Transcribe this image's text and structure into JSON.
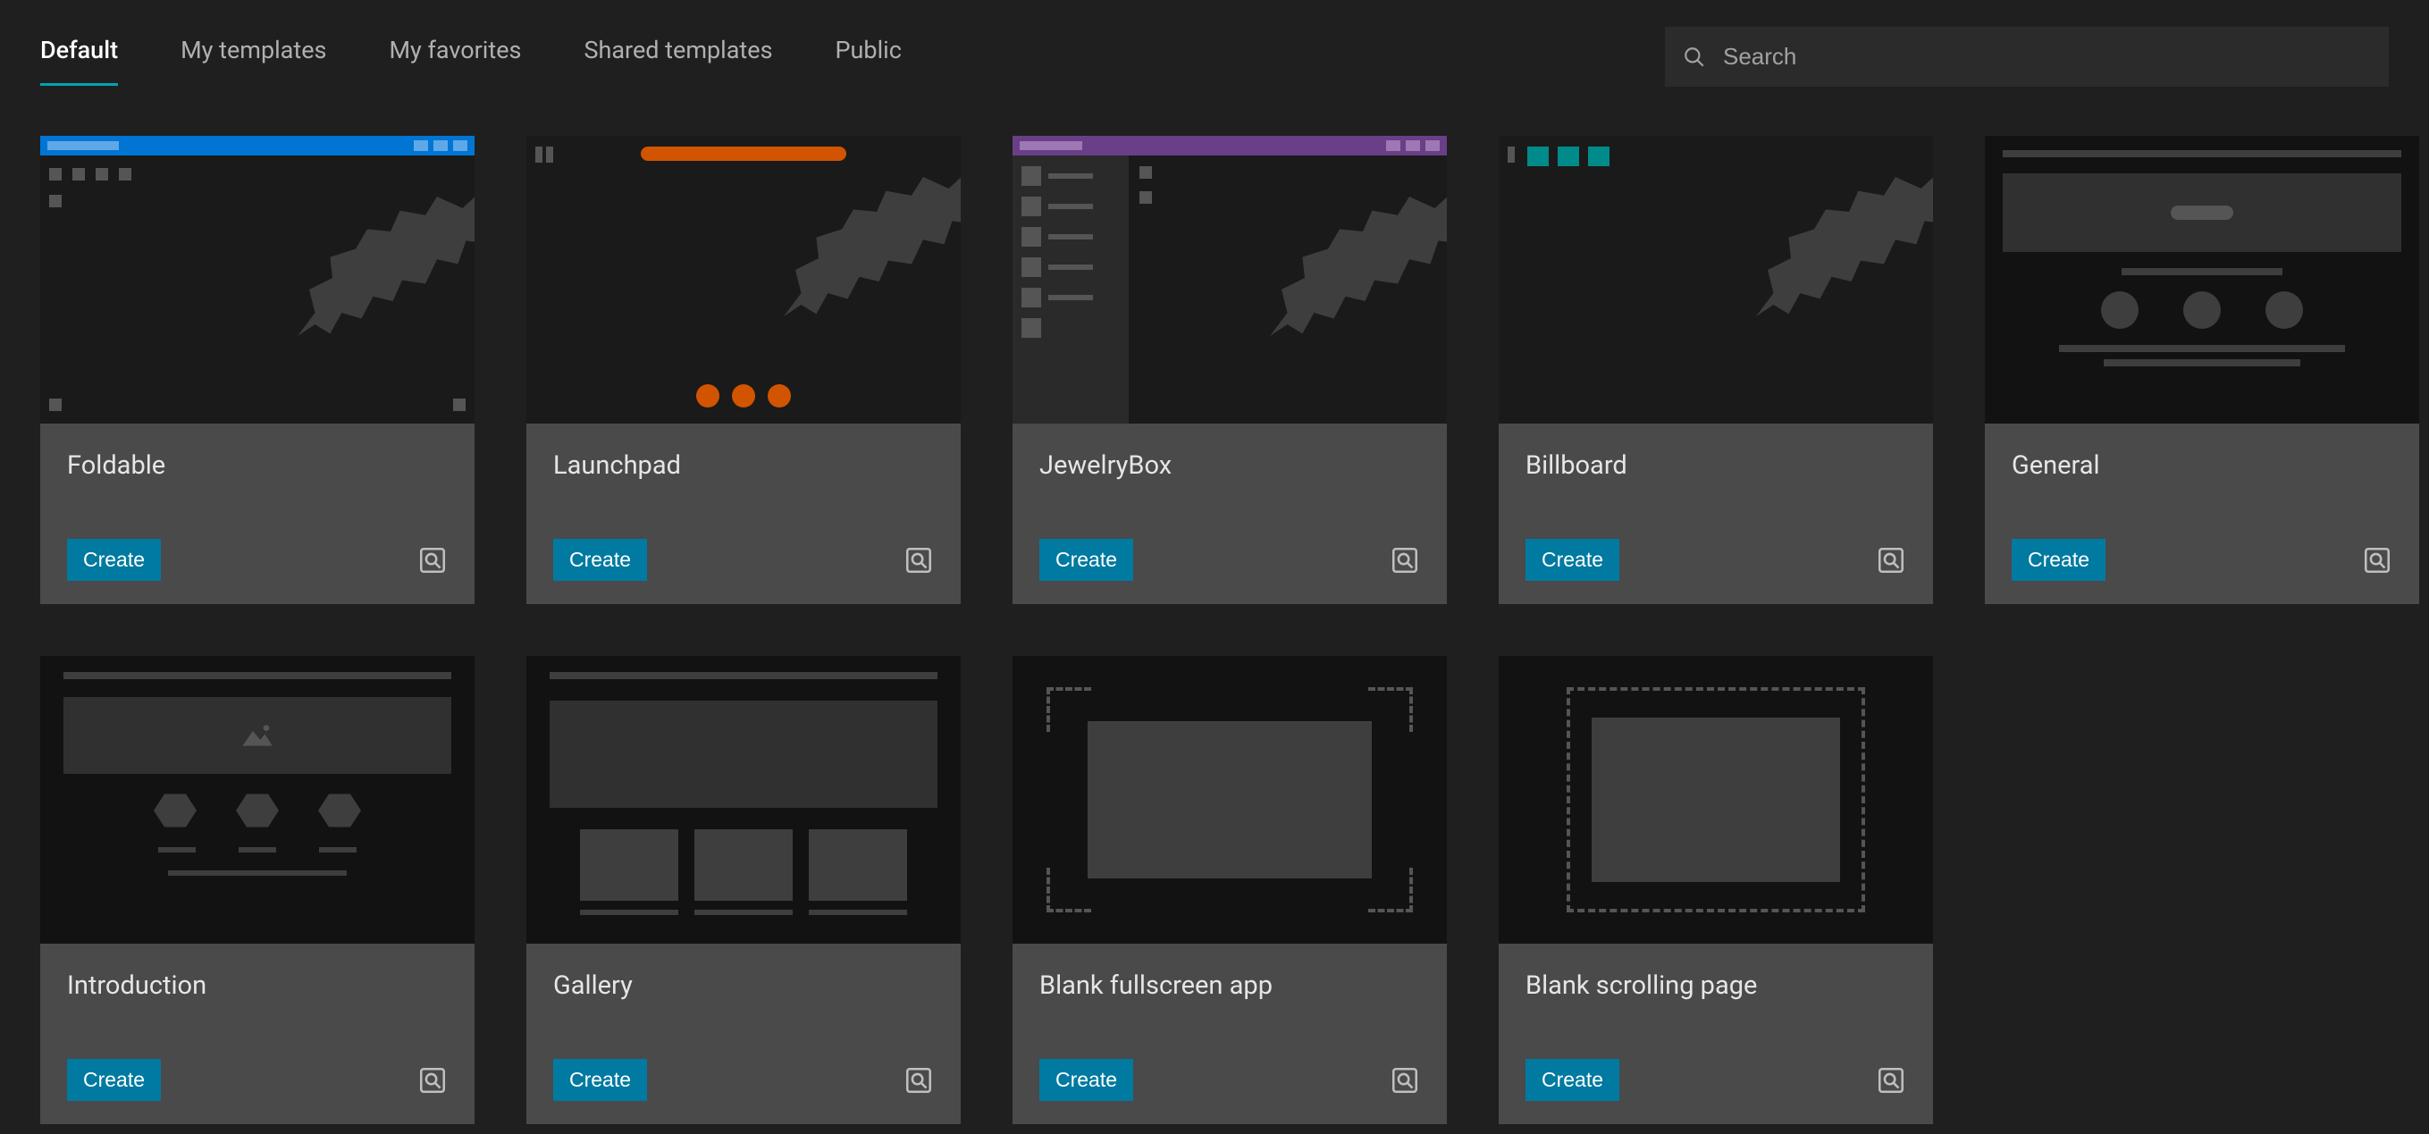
{
  "tabs": {
    "default": "Default",
    "my_templates": "My templates",
    "my_favorites": "My favorites",
    "shared_templates": "Shared templates",
    "public": "Public"
  },
  "search": {
    "placeholder": "Search"
  },
  "buttons": {
    "create": "Create"
  },
  "templates": {
    "foldable": "Foldable",
    "launchpad": "Launchpad",
    "jewelrybox": "JewelryBox",
    "billboard": "Billboard",
    "general": "General",
    "introduction": "Introduction",
    "gallery": "Gallery",
    "blank_fullscreen": "Blank fullscreen app",
    "blank_scrolling": "Blank scrolling page"
  },
  "colors": {
    "accent": "#007aa0",
    "blue_bar": "#0075d3",
    "orange": "#d35400",
    "purple": "#6a3f87",
    "teal": "#008a8a"
  }
}
